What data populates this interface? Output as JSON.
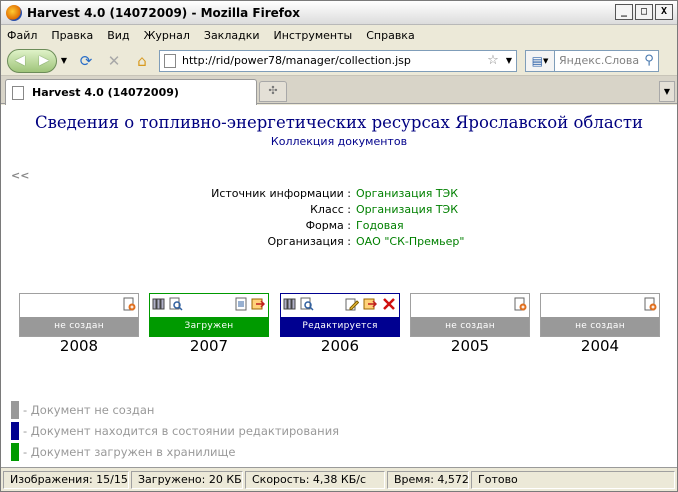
{
  "window": {
    "title": "Harvest 4.0 (14072009) - Mozilla Firefox",
    "minimize": "_",
    "maximize": "□",
    "close": "X"
  },
  "menu": [
    "Файл",
    "Правка",
    "Вид",
    "Журнал",
    "Закладки",
    "Инструменты",
    "Справка"
  ],
  "nav": {
    "url": "http://rid/power78/manager/collection.jsp",
    "search_placeholder": "Яндекс.Словари"
  },
  "tabs": {
    "active": "Harvest 4.0 (14072009)"
  },
  "page": {
    "title": "Сведения о топливно-энергетических ресурсах Ярославской области",
    "subtitle": "Коллекция документов",
    "back": "<<",
    "info": [
      {
        "label": "Источник информации :",
        "value": "Организация ТЭК"
      },
      {
        "label": "Класс :",
        "value": "Организация ТЭК"
      },
      {
        "label": "Форма :",
        "value": "Годовая"
      },
      {
        "label": "Организация :",
        "value": "ОАО \"СК-Премьер\""
      }
    ],
    "years": [
      {
        "year": "2008",
        "status": "не создан"
      },
      {
        "year": "2007",
        "status": "Загружен"
      },
      {
        "year": "2006",
        "status": "Редактируется"
      },
      {
        "year": "2005",
        "status": "не создан"
      },
      {
        "year": "2004",
        "status": "не создан"
      }
    ],
    "legend": [
      {
        "text": "- Документ не создан",
        "color": "#999999"
      },
      {
        "text": "- Документ находится в состоянии редактирования",
        "color": "#000090"
      },
      {
        "text": "- Документ загружен в хранилище",
        "color": "#009a00"
      }
    ]
  },
  "status": {
    "images": "Изображения: 15/15",
    "loaded": "Загружено: 20 КБ",
    "speed": "Скорость: 4,38 КБ/с",
    "time": "Время: 4,572",
    "ready": "Готово"
  }
}
